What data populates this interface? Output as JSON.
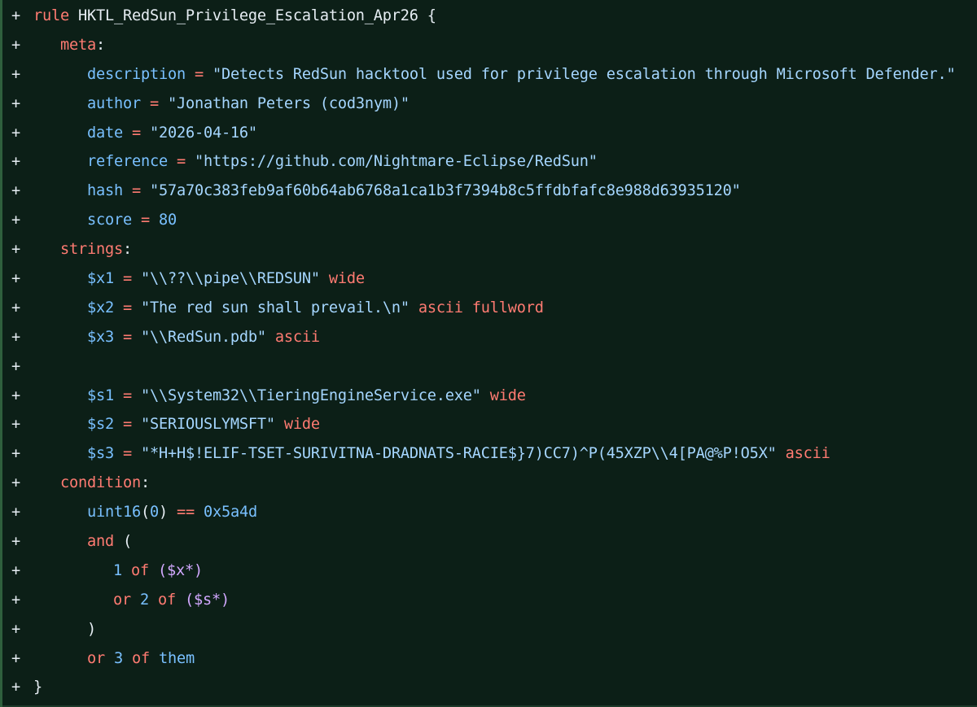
{
  "diff_marker": "+",
  "lines": {
    "l1": {
      "rule_kw": "rule",
      "rule_name": "HKTL_RedSun_Privilege_Escalation_Apr26",
      "brace": "{"
    },
    "l2": {
      "section": "meta",
      "colon": ":"
    },
    "l3": {
      "key": "description",
      "eq": "=",
      "value": "\"Detects RedSun hacktool used for privilege escalation through Microsoft Defender.\""
    },
    "l4": {
      "key": "author",
      "eq": "=",
      "value": "\"Jonathan Peters (cod3nym)\""
    },
    "l5": {
      "key": "date",
      "eq": "=",
      "value": "\"2026-04-16\""
    },
    "l6": {
      "key": "reference",
      "eq": "=",
      "value": "\"https://github.com/Nightmare-Eclipse/RedSun\""
    },
    "l7": {
      "key": "hash",
      "eq": "=",
      "value": "\"57a70c383feb9af60b64ab6768a1ca1b3f7394b8c5ffdbfafc8e988d63935120\""
    },
    "l8": {
      "key": "score",
      "eq": "=",
      "value": "80"
    },
    "l9": {
      "section": "strings",
      "colon": ":"
    },
    "l10": {
      "var": "$x1",
      "eq": "=",
      "value": "\"\\\\??\\\\pipe\\\\REDSUN\"",
      "mods": "wide"
    },
    "l11": {
      "var": "$x2",
      "eq": "=",
      "value": "\"The red sun shall prevail.\\n\"",
      "mods": "ascii fullword"
    },
    "l12": {
      "var": "$x3",
      "eq": "=",
      "value": "\"\\\\RedSun.pdb\"",
      "mods": "ascii"
    },
    "l13": {},
    "l14": {
      "var": "$s1",
      "eq": "=",
      "value": "\"\\\\System32\\\\TieringEngineService.exe\"",
      "mods": "wide"
    },
    "l15": {
      "var": "$s2",
      "eq": "=",
      "value": "\"SERIOUSLYMSFT\"",
      "mods": "wide"
    },
    "l16": {
      "var": "$s3",
      "eq": "=",
      "value": "\"*H+H$!ELIF-TSET-SURIVITNA-DRADNATS-RACIE$}7)CC7)^P(45XZP\\\\4[PA@%P!O5X\"",
      "mods": "ascii"
    },
    "l17": {
      "section": "condition",
      "colon": ":"
    },
    "l18": {
      "fn": "uint16",
      "open": "(",
      "arg": "0",
      "close": ")",
      "op": "==",
      "num": "0x5a4d"
    },
    "l19": {
      "kw": "and",
      "paren": "("
    },
    "l20": {
      "count": "1",
      "of": "of",
      "set": "($x*)"
    },
    "l21": {
      "kw": "or",
      "count": "2",
      "of": "of",
      "set": "($s*)"
    },
    "l22": {
      "paren": ")"
    },
    "l23": {
      "kw": "or",
      "count": "3",
      "of": "of",
      "target": "them"
    },
    "l24": {
      "brace": "}"
    }
  },
  "colors": {
    "background": "#0c1f17",
    "keyword": "#ff7b72",
    "string": "#a5d6ff",
    "variable": "#79c0ff",
    "function": "#d2a8ff",
    "text": "#e6edf3"
  }
}
